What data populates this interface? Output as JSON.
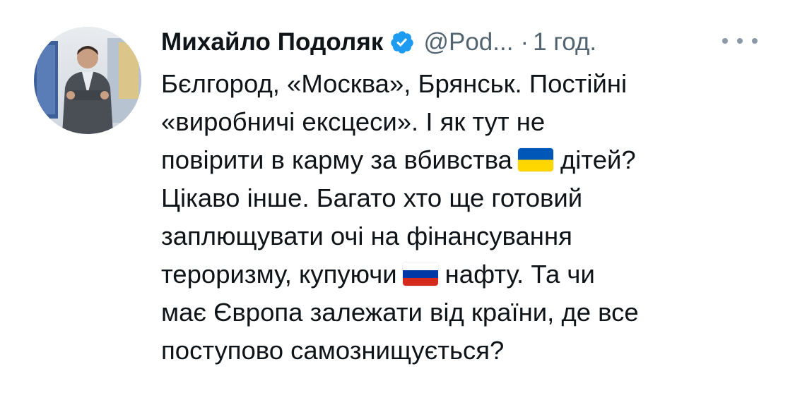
{
  "tweet": {
    "author": {
      "name": "Михайло Подоляк",
      "handle": "@Pod...",
      "verified": true,
      "avatar_icon": "profile-photo"
    },
    "separator": "·",
    "time": "1 год.",
    "more_icon": "more-horizontal-icon",
    "text": {
      "line1": "Бєлгород, «Москва», Брянськ. Постійні",
      "line2": "«виробничі ексцеси». І як тут не",
      "line3_before": "повірити в карму за вбивства",
      "flag_ua": "ukraine-flag",
      "line3_after": "дітей?",
      "line4": "Цікаво інше. Багато хто ще готовий",
      "line5": "заплющувати очі на фінансування",
      "line6_before": "тероризму, купуючи",
      "flag_ru": "russia-flag",
      "line6_after": "нафту. Та чи",
      "line7": "має Європа залежати від країни, де все",
      "line8": "поступово самознищується?"
    }
  },
  "colors": {
    "text": "#0f1419",
    "secondary": "#536471",
    "verified_blue": "#1d9bf0",
    "ua_blue": "#0057b7",
    "ua_yellow": "#ffd700",
    "ru_white": "#ffffff",
    "ru_blue": "#0039a6",
    "ru_red": "#d52b1e"
  }
}
